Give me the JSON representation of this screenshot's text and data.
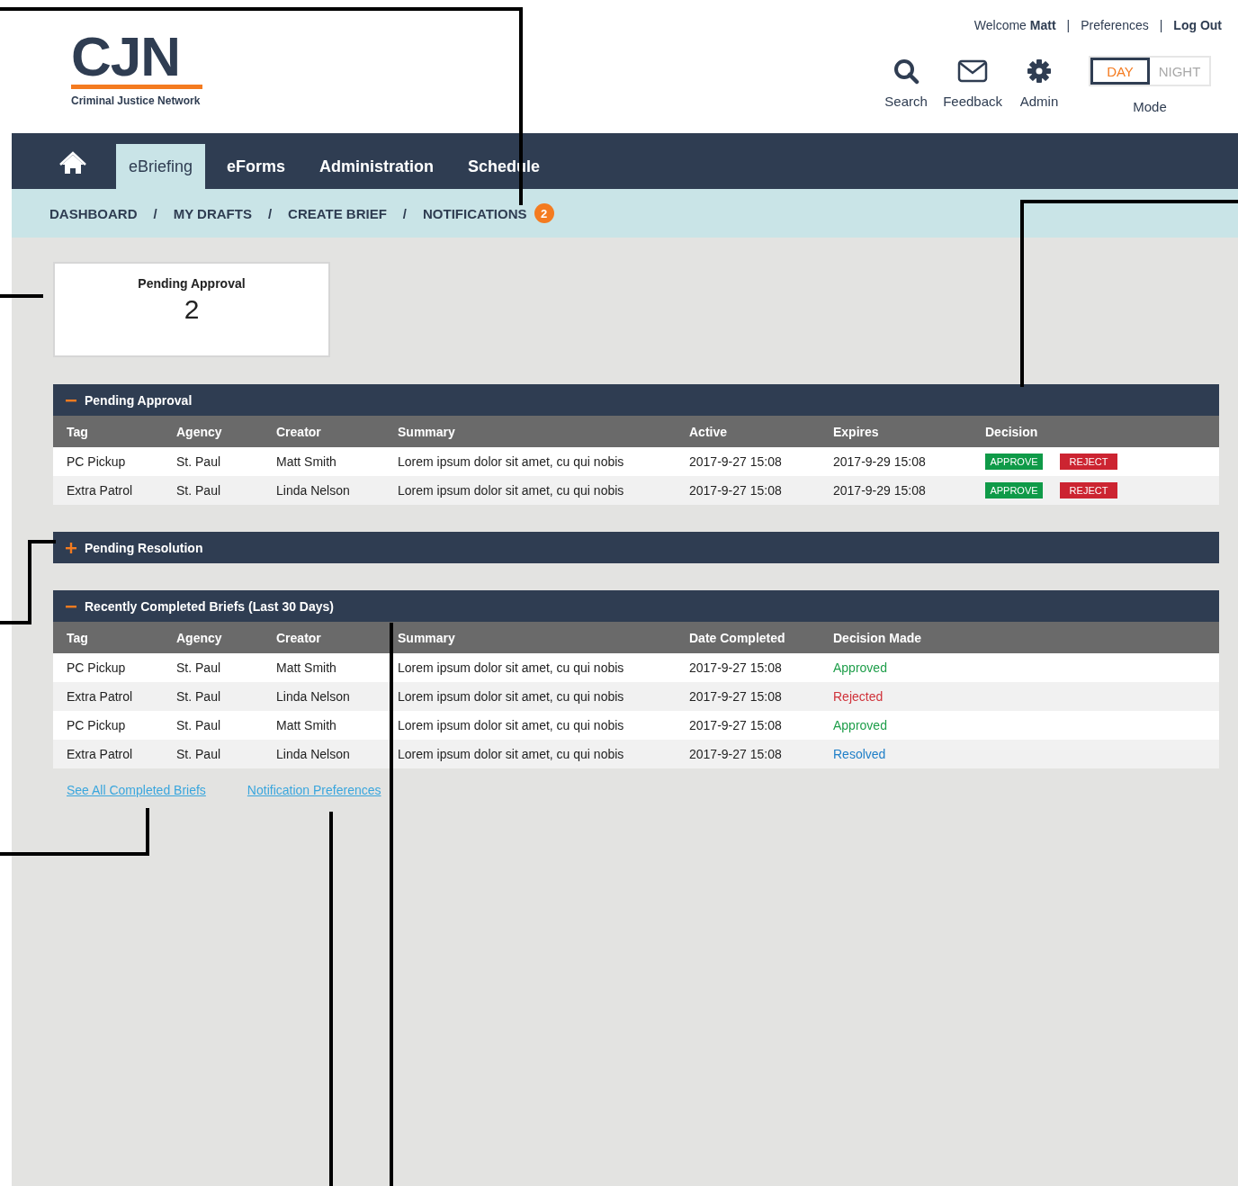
{
  "header": {
    "logo": {
      "mark": "CJN",
      "tagline": "Criminal Justice Network"
    },
    "user_bar": {
      "welcome": "Welcome",
      "user": "Matt",
      "separator": "|",
      "links": [
        "Preferences",
        "Log Out"
      ]
    },
    "tools": [
      {
        "kind": "search",
        "label": "Search"
      },
      {
        "kind": "feedback",
        "label": "Feedback"
      },
      {
        "kind": "admin",
        "label": "Admin"
      }
    ],
    "mode": {
      "options": [
        {
          "label": "DAY",
          "selected": true
        },
        {
          "label": "NIGHT",
          "selected": false
        }
      ],
      "caption": "Mode"
    }
  },
  "nav": {
    "tabs": [
      {
        "label": "eBriefing",
        "selected": true
      },
      {
        "label": "eForms",
        "selected": false
      },
      {
        "label": "Administration",
        "selected": false
      },
      {
        "label": "Schedule",
        "selected": false
      }
    ]
  },
  "breadcrumb": {
    "separator": "/",
    "items": [
      "DASHBOARD",
      "MY DRAFTS",
      "CREATE BRIEF",
      "NOTIFICATIONS"
    ],
    "badge": "2"
  },
  "summary_card": {
    "label": "Pending Approval",
    "value": "2"
  },
  "sections": [
    {
      "title": "Pending Approval",
      "expanded": true,
      "columns": [
        "Tag",
        "Agency",
        "Creator",
        "Summary",
        "Active",
        "Expires",
        "Decision"
      ],
      "rows": [
        {
          "cells": [
            "PC Pickup",
            "St. Paul",
            "Matt Smith",
            "Lorem ipsum dolor sit amet, cu qui nobis",
            "2017-9-27 15:08",
            "2017-9-29 15:08"
          ],
          "actions": [
            {
              "kind": "approve",
              "label": "APPROVE"
            },
            {
              "kind": "reject",
              "label": "REJECT"
            }
          ]
        },
        {
          "cells": [
            "Extra Patrol",
            "St. Paul",
            "Linda Nelson",
            "Lorem ipsum dolor sit amet, cu qui nobis",
            "2017-9-27 15:08",
            "2017-9-29 15:08"
          ],
          "actions": [
            {
              "kind": "approve",
              "label": "APPROVE"
            },
            {
              "kind": "reject",
              "label": "REJECT"
            }
          ]
        }
      ]
    },
    {
      "title": "Pending Resolution",
      "expanded": false
    },
    {
      "title": "Recently Completed Briefs (Last 30 Days)",
      "expanded": true,
      "columns": [
        "Tag",
        "Agency",
        "Creator",
        "Summary",
        "Date Completed",
        "Decision Made"
      ],
      "rows": [
        {
          "cells": [
            "PC Pickup",
            "St. Paul",
            "Matt Smith",
            "Lorem ipsum dolor sit amet, cu qui nobis",
            "2017-9-27 15:08"
          ],
          "decision": {
            "kind": "approved",
            "label": "Approved"
          }
        },
        {
          "cells": [
            "Extra Patrol",
            "St. Paul",
            "Linda Nelson",
            "Lorem ipsum dolor sit amet, cu qui nobis",
            "2017-9-27 15:08"
          ],
          "decision": {
            "kind": "rejected",
            "label": "Rejected"
          }
        },
        {
          "cells": [
            "PC Pickup",
            "St. Paul",
            "Matt Smith",
            "Lorem ipsum dolor sit amet, cu qui nobis",
            "2017-9-27 15:08"
          ],
          "decision": {
            "kind": "approved",
            "label": "Approved"
          }
        },
        {
          "cells": [
            "Extra Patrol",
            "St. Paul",
            "Linda Nelson",
            "Lorem ipsum dolor sit amet, cu qui nobis",
            "2017-9-27 15:08"
          ],
          "decision": {
            "kind": "resolved",
            "label": "Resolved"
          }
        }
      ],
      "links": [
        "See All Completed Briefs",
        "Notification Preferences"
      ]
    }
  ]
}
